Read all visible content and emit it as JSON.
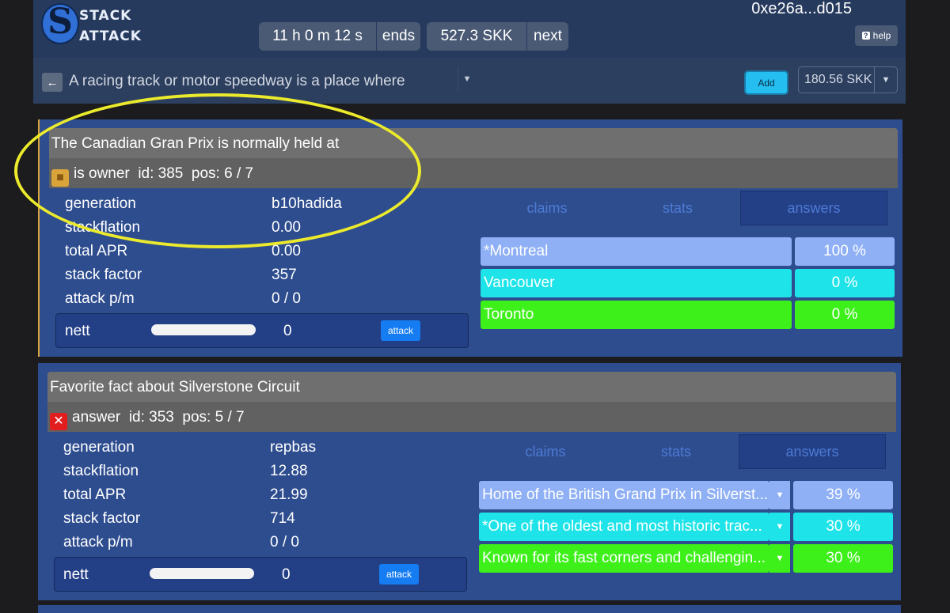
{
  "header": {
    "logo_line1": "STACK",
    "logo_line2": "ATTACK",
    "logo_glyph": "S",
    "timer": "11 h 0 m 12 s",
    "timer_suffix": "ends",
    "amount": "527.3 SKK",
    "amount_suffix": "next",
    "account": "0xe26a...d015",
    "help_label": "help",
    "help_icon": "?"
  },
  "question_bar": {
    "back_icon": "←",
    "text": "A racing track or motor speedway is a place where",
    "add_label": "Add",
    "stake_value": "180.56 SKK"
  },
  "cards": [
    {
      "title": "The Canadian Gran Prix is normally held at",
      "role": "is owner",
      "role_icon": "owner-icon",
      "id_text": "id: 385",
      "pos_text": "pos: 6 / 7",
      "stats": [
        {
          "label": "generation",
          "value": "b10hadida"
        },
        {
          "label": "stackflation",
          "value": "0.00"
        },
        {
          "label": "total APR",
          "value": "0.00"
        },
        {
          "label": "stack factor",
          "value": "357"
        },
        {
          "label": "attack p/m",
          "value": "0 / 0"
        }
      ],
      "nett_label": "nett",
      "nett_value": "0",
      "attack_label": "attack",
      "tabs": [
        "claims",
        "stats",
        "answers"
      ],
      "active_tab": "answers",
      "answers": [
        {
          "text": "*Montreal",
          "pct": "100 %",
          "color": "#8fb0f5"
        },
        {
          "text": "Vancouver",
          "pct": "0 %",
          "color": "#1ee3e8"
        },
        {
          "text": "Toronto",
          "pct": "0 %",
          "color": "#3ef01a"
        }
      ]
    },
    {
      "title": "Favorite fact about Silverstone Circuit",
      "role": "answer",
      "role_icon": "x-icon",
      "id_text": "id: 353",
      "pos_text": "pos: 5 / 7",
      "stats": [
        {
          "label": "generation",
          "value": "repbas"
        },
        {
          "label": "stackflation",
          "value": "12.88"
        },
        {
          "label": "total APR",
          "value": "21.99"
        },
        {
          "label": "stack factor",
          "value": "714"
        },
        {
          "label": "attack p/m",
          "value": "0 / 0"
        }
      ],
      "nett_label": "nett",
      "nett_value": "0",
      "attack_label": "attack",
      "tabs": [
        "claims",
        "stats",
        "answers"
      ],
      "active_tab": "answers",
      "answers": [
        {
          "text": "Home of the British Grand Prix in Silverst...",
          "pct": "39 %",
          "color": "#8fb0f5"
        },
        {
          "text": "*One of the oldest and most historic trac...",
          "pct": "30 %",
          "color": "#1ee3e8"
        },
        {
          "text": "Known for its fast corners and challengin...",
          "pct": "30 %",
          "color": "#3ef01a"
        }
      ]
    }
  ]
}
